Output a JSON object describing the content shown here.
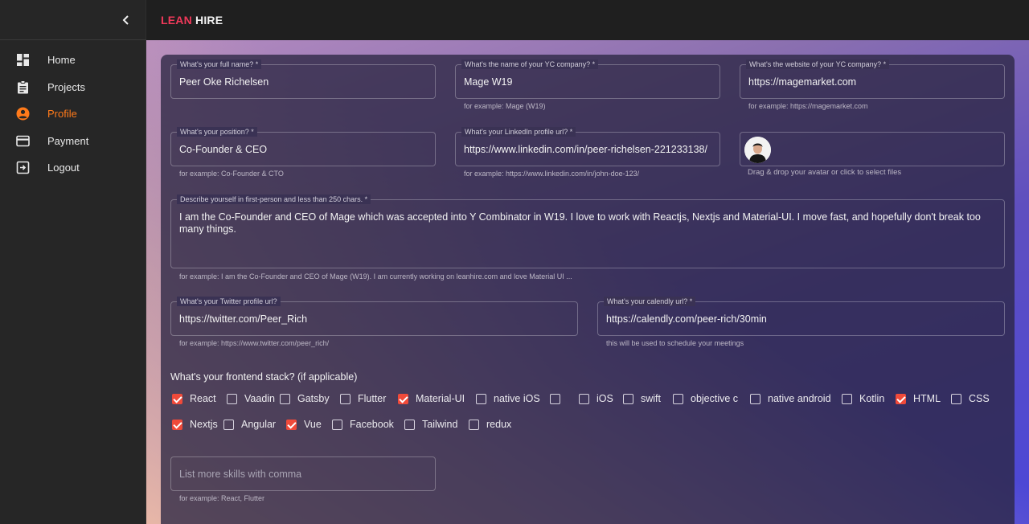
{
  "app": {
    "brand_part1": "LEAN",
    "brand_part2": "HIRE"
  },
  "sidebar": {
    "items": [
      {
        "label": "Home",
        "icon": "dashboard-icon",
        "active": false
      },
      {
        "label": "Projects",
        "icon": "clipboard-icon",
        "active": false
      },
      {
        "label": "Profile",
        "icon": "account-circle-icon",
        "active": true
      },
      {
        "label": "Payment",
        "icon": "credit-card-icon",
        "active": false
      },
      {
        "label": "Logout",
        "icon": "logout-icon",
        "active": false
      }
    ]
  },
  "form": {
    "full_name": {
      "label": "What's your full name? *",
      "value": "Peer Oke Richelsen"
    },
    "company": {
      "label": "What's the name of your YC company? *",
      "value": "Mage W19",
      "helper": "for example: Mage (W19)"
    },
    "website": {
      "label": "What's the website of your YC company? *",
      "value": "https://magemarket.com",
      "helper": "for example: https://magemarket.com"
    },
    "position": {
      "label": "What's your position? *",
      "value": "Co-Founder & CEO",
      "helper": "for example: Co-Founder & CTO"
    },
    "linkedin": {
      "label": "What's your LinkedIn profile url? *",
      "value": "https://www.linkedin.com/in/peer-richelsen-221233138/",
      "helper": "for example: https://www.linkedin.com/in/john-doe-123/"
    },
    "avatar": {
      "helper": "Drag & drop your avatar or click to select files"
    },
    "bio": {
      "label": "Describe yourself in first-person and less than 250 chars. *",
      "value": "I am the Co-Founder and CEO of Mage which was accepted into Y Combinator in W19. I love to work with Reactjs, Nextjs and Material-UI. I move fast, and hopefully don't break too many things.",
      "helper": "for example: I am the Co-Founder and CEO of Mage (W19). I am currently working on leanhire.com and love Material UI ..."
    },
    "twitter": {
      "label": "What's your Twitter profile url?",
      "value": "https://twitter.com/Peer_Rich",
      "helper": "for example: https://www.twitter.com/peer_rich/"
    },
    "calendly": {
      "label": "What's your calendly url? *",
      "value": "https://calendly.com/peer-rich/30min",
      "helper": "this will be used to schedule your meetings"
    },
    "stack_title": "What's your frontend stack? (if applicable)",
    "stack_row1": [
      {
        "label": "React",
        "checked": true
      },
      {
        "label": "Vaadin",
        "checked": false
      },
      {
        "label": "Gatsby",
        "checked": false
      },
      {
        "label": "Flutter",
        "checked": false
      },
      {
        "label": "Material-UI",
        "checked": true
      },
      {
        "label": "native iOS",
        "checked": false
      },
      {
        "label": "",
        "checked": false
      },
      {
        "label": "iOS",
        "checked": false
      },
      {
        "label": "swift",
        "checked": false
      },
      {
        "label": "objective c",
        "checked": false
      },
      {
        "label": "native android",
        "checked": false
      },
      {
        "label": "Kotlin",
        "checked": false
      },
      {
        "label": "HTML",
        "checked": true
      },
      {
        "label": "CSS",
        "checked": false
      }
    ],
    "stack_row2": [
      {
        "label": "Nextjs",
        "checked": true
      },
      {
        "label": "Angular",
        "checked": false
      },
      {
        "label": "Vue",
        "checked": true
      },
      {
        "label": "Facebook",
        "checked": false
      },
      {
        "label": "Tailwind",
        "checked": false
      },
      {
        "label": "redux",
        "checked": false
      }
    ],
    "more_skills": {
      "placeholder": "List more skills with comma",
      "helper": "for example: React, Flutter"
    }
  }
}
